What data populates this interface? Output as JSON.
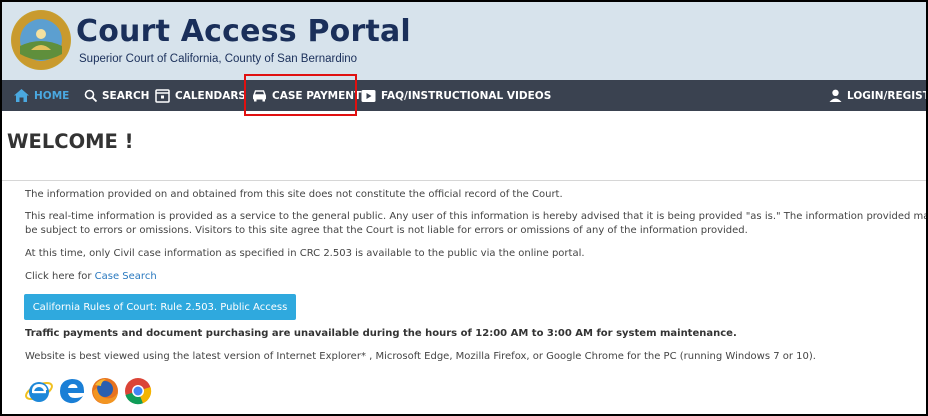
{
  "header": {
    "title": "Court Access Portal",
    "subtitle": "Superior Court of California, County of San Bernardino",
    "seal_icon": "court-seal-icon"
  },
  "nav": {
    "items": [
      {
        "label": "HOME",
        "icon": "home-icon"
      },
      {
        "label": "SEARCH",
        "icon": "search-icon"
      },
      {
        "label": "CALENDARS",
        "icon": "calendar-icon"
      },
      {
        "label": "CASE PAYMENT",
        "icon": "car-icon"
      },
      {
        "label": "FAQ/INSTRUCTIONAL VIDEOS",
        "icon": "video-icon"
      }
    ],
    "login": {
      "label": "LOGIN/REGISTER",
      "icon": "user-icon"
    }
  },
  "main": {
    "heading": "WELCOME !",
    "p1": "The information provided on and obtained from this site does not constitute the official record of the Court.",
    "p2_line1": "This real-time information is provided as a service to the general public. Any user of this information is hereby advised that it is being provided \"as is.\" The information provided may",
    "p2_line2": "be subject to errors or omissions. Visitors to this site agree that the Court is not liable for errors or omissions of any of the information provided.",
    "p3": "At this time, only Civil case information as specified in CRC 2.503 is available to the public via the online portal.",
    "click_prefix": "Click here for ",
    "case_search_link": "Case Search",
    "rule_button": "California Rules of Court: Rule 2.503. Public Access",
    "maintenance": "Traffic payments and document purchasing are unavailable during the hours of 12:00 AM to 3:00 AM for system maintenance.",
    "browser_note": "Website is best viewed using the latest version of Internet Explorer* , Microsoft Edge, Mozilla Firefox, or Google Chrome for the PC (running Windows 7 or 10).",
    "browser_icons": [
      "internet-explorer-icon",
      "edge-icon",
      "firefox-icon",
      "chrome-icon"
    ]
  },
  "colors": {
    "header_bg": "#d7e3ec",
    "navbar_bg": "#3a4250",
    "accent": "#2fa9de",
    "highlight": "#e01010",
    "title": "#1a2f5a"
  }
}
